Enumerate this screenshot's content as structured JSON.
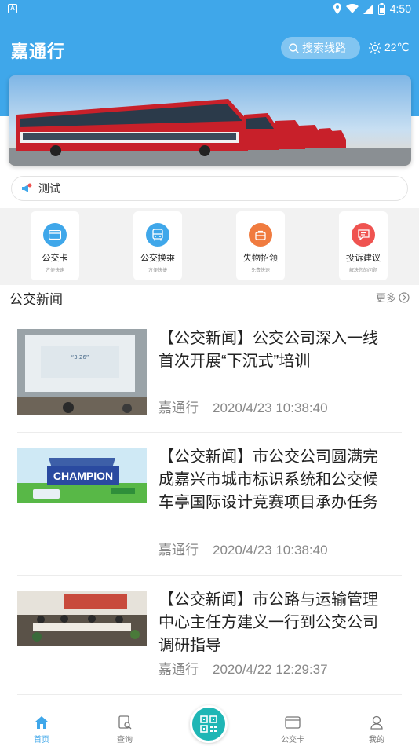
{
  "status_bar": {
    "time": "4:50"
  },
  "header": {
    "title": "嘉通行",
    "search_label": "搜索线路",
    "weather": "22℃"
  },
  "notice": {
    "text": "测试"
  },
  "quick_menu": [
    {
      "label": "公交卡",
      "sub": "方便快速",
      "color": "#3fa7ea",
      "icon": "card-icon"
    },
    {
      "label": "公交换乘",
      "sub": "方便快捷",
      "color": "#3fa7ea",
      "icon": "bus-icon"
    },
    {
      "label": "失物招领",
      "sub": "免费快速",
      "color": "#f07b3f",
      "icon": "bag-icon"
    },
    {
      "label": "投诉建议",
      "sub": "解决您的问题",
      "color": "#ef5350",
      "icon": "message-icon"
    }
  ],
  "news_section": {
    "title": "公交新闻",
    "more": "更多"
  },
  "news": [
    {
      "title": "【公交新闻】公交公司深入一线 首次开展“下沉式”培训",
      "source": "嘉通行",
      "time": "2020/4/23 10:38:40",
      "thumb_text": "“3.26”"
    },
    {
      "title": "【公交新闻】市公交公司圆满完成嘉兴市城市标识系统和公交候车亭国际设计竞赛项目承办任务",
      "source": "嘉通行",
      "time": "2020/4/23 10:38:40",
      "thumb_text": "CHAMPION"
    },
    {
      "title": "【公交新闻】市公路与运输管理中心主任方建义一行到公交公司调研指导",
      "source": "嘉通行",
      "time": "2020/4/22 12:29:37"
    }
  ],
  "tabbar": [
    {
      "label": "首页",
      "icon": "home-icon"
    },
    {
      "label": "查询",
      "icon": "query-icon"
    },
    {
      "label": "公交卡",
      "icon": "card-icon"
    },
    {
      "label": "我的",
      "icon": "user-icon"
    }
  ],
  "colors": {
    "primary": "#3fa7ea",
    "scan": "#1fb6b5"
  }
}
